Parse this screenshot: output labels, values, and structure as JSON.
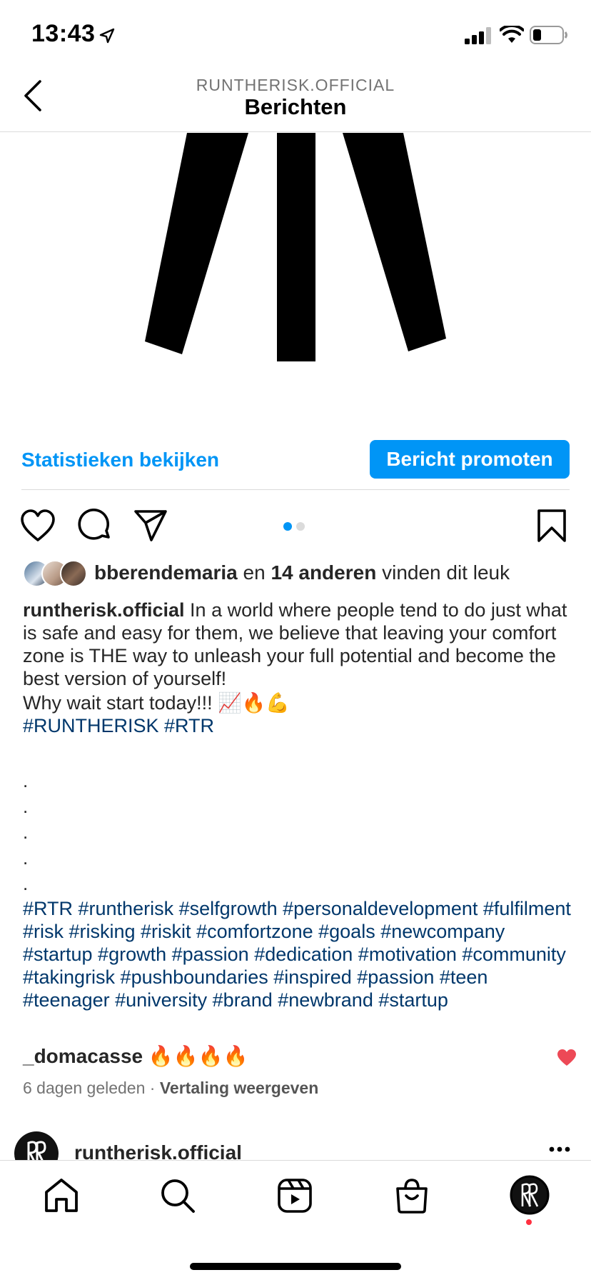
{
  "status_bar": {
    "time": "13:43",
    "icons": [
      "location-arrow-icon",
      "signal-icon",
      "wifi-icon",
      "battery-icon"
    ]
  },
  "header": {
    "account": "RUNTHERISK.OFFICIAL",
    "title": "Berichten"
  },
  "insights": {
    "link_label": "Statistieken bekijken",
    "promote_label": "Bericht promoten"
  },
  "carousel": {
    "current": 1,
    "total": 2
  },
  "likes": {
    "first_user": "bberendemaria",
    "connector": " en ",
    "others": "14 anderen",
    "suffix": " vinden dit leuk"
  },
  "caption": {
    "user": "runtherisk.official",
    "text": " In a world where people tend to do just what is safe and easy for them, we believe that leaving your comfort zone is THE way to unleash your full potential and become the best version of yourself!",
    "line2": "Why wait start today!!! 📈🔥💪",
    "tags1": "#RUNTHERISK #RTR",
    "bullets": [
      ".",
      ".",
      ".",
      ".",
      "."
    ],
    "tags2": "#RTR #runtherisk #selfgrowth #personaldevelopment #fulfilment #risk #risking #riskit #comfortzone #goals #newcompany #startup #growth #passion #dedication #motivation #community #takingrisk #pushboundaries #inspired #passion #teen #teenager #university #brand #newbrand #startup"
  },
  "comment": {
    "user": "_domacasse",
    "text": " 🔥🔥🔥🔥",
    "liked": true
  },
  "meta": {
    "time_ago": "6 dagen geleden",
    "separator": " · ",
    "translate": "Vertaling weergeven"
  },
  "next_post": {
    "user": "runtherisk.official"
  },
  "tab_bar": {
    "tabs": [
      "home-icon",
      "search-icon",
      "reels-icon",
      "shop-icon",
      "profile-icon"
    ]
  },
  "colors": {
    "accent": "#0095f6",
    "hashtag": "#00376b",
    "like_red": "#ed4956",
    "text": "#262626",
    "muted": "#737373"
  }
}
